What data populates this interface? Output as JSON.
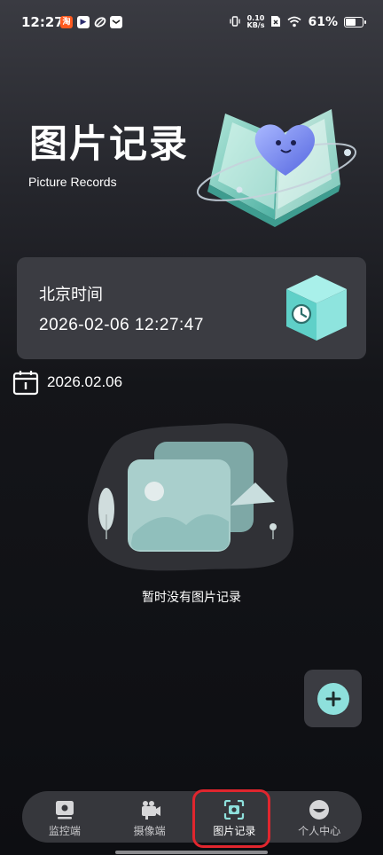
{
  "status_bar": {
    "time": "12:27",
    "net_speed_value": "0.10",
    "net_speed_unit": "KB/s",
    "battery_percent": "61%",
    "battery_level": 0.61,
    "icons": [
      "taobao-app-icon",
      "video-app-icon",
      "leaf-app-icon",
      "message-app-icon",
      "vibrate-icon",
      "no-sim-icon",
      "wifi-icon",
      "battery-icon"
    ]
  },
  "header": {
    "title": "图片记录",
    "subtitle": "Picture Records",
    "hero_icon": "open-book-heart-illustration"
  },
  "time_card": {
    "label": "北京时间",
    "value": "2026-02-06 12:27:47",
    "icon": "clock-cube-icon"
  },
  "date_row": {
    "icon": "calendar-icon",
    "date": "2026.02.06"
  },
  "empty_state": {
    "illustration": "empty-pictures-illustration",
    "message": "暂时没有图片记录"
  },
  "add_button": {
    "icon": "plus-icon"
  },
  "tab_bar": {
    "tabs": [
      {
        "label": "监控端",
        "icon": "monitor-icon",
        "active": false
      },
      {
        "label": "摄像端",
        "icon": "camera-device-icon",
        "active": false
      },
      {
        "label": "图片记录",
        "icon": "scan-camera-icon",
        "active": true
      },
      {
        "label": "个人中心",
        "icon": "profile-icon",
        "active": false
      }
    ]
  },
  "colors": {
    "accent": "#8ee0dc",
    "card_bg": "#3b3c42",
    "tab_bar_bg": "#36373c",
    "highlight_border": "#e0262e"
  }
}
